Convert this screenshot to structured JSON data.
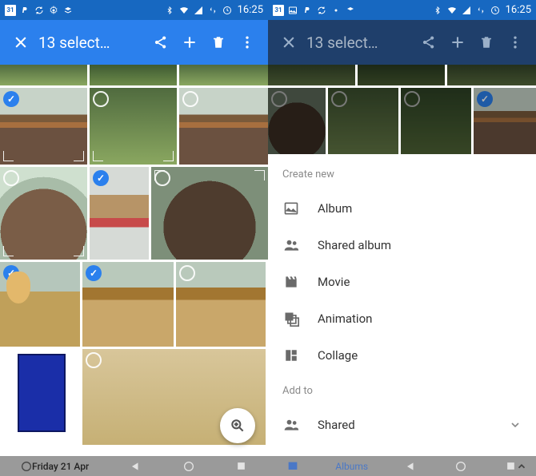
{
  "status": {
    "cal_day": "31",
    "time": "16:25"
  },
  "appbar": {
    "title": "13 select…"
  },
  "sheet": {
    "create_title": "Create new",
    "items": [
      {
        "label": "Album"
      },
      {
        "label": "Shared album"
      },
      {
        "label": "Movie"
      },
      {
        "label": "Animation"
      },
      {
        "label": "Collage"
      }
    ],
    "addto_title": "Add to",
    "addto_items": [
      {
        "label": "Shared"
      }
    ]
  },
  "navbar": {
    "date_label": "Friday 21 Apr",
    "albums_label": "Albums"
  }
}
